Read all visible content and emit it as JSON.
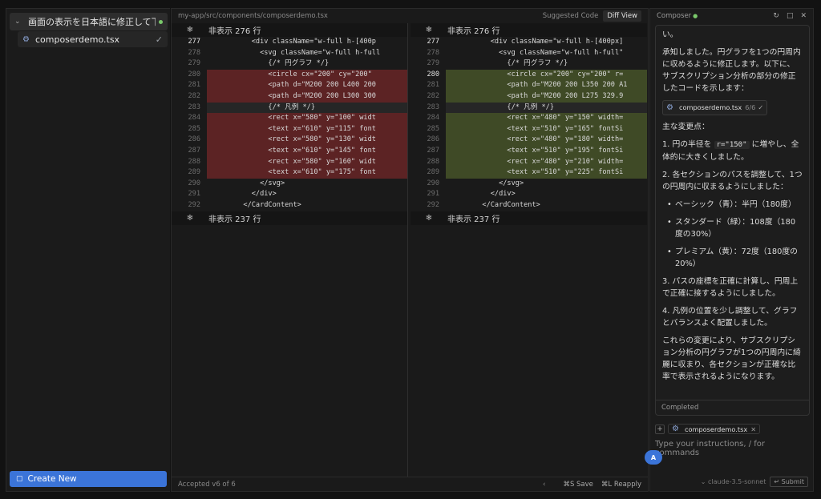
{
  "sidebar": {
    "conversation_title": "画面の表示を日本語に修正して下...",
    "file_name": "composerdemo.tsx",
    "create_new_label": "Create New"
  },
  "diff": {
    "file_path": "my-app/src/components/composerdemo.tsx",
    "suggested_code_label": "Suggested Code",
    "diff_view_label": "Diff View",
    "hidden_top": "非表示 276 行",
    "hidden_bottom": "非表示 237 行",
    "left_lines": [
      {
        "n": "277",
        "type": "ctx",
        "code": "          <div className=\"w-full h-[400p"
      },
      {
        "n": "278",
        "type": "ctx",
        "code": "            <svg className=\"w-full h-full"
      },
      {
        "n": "279",
        "type": "ctx",
        "code": "              {/* 円グラフ */}"
      },
      {
        "n": "280",
        "type": "del",
        "code": "              <circle cx=\"200\" cy=\"200\" "
      },
      {
        "n": "281",
        "type": "del",
        "code": "              <path d=\"M200 200 L400 200"
      },
      {
        "n": "282",
        "type": "del",
        "code": "              <path d=\"M200 200 L300 300"
      },
      {
        "n": "283",
        "type": "sel",
        "code": "              {/* 凡例 */}"
      },
      {
        "n": "284",
        "type": "del",
        "code": "              <rect x=\"580\" y=\"100\" widt"
      },
      {
        "n": "285",
        "type": "del",
        "code": "              <text x=\"610\" y=\"115\" font"
      },
      {
        "n": "286",
        "type": "del",
        "code": "              <rect x=\"580\" y=\"130\" widt"
      },
      {
        "n": "287",
        "type": "del",
        "code": "              <text x=\"610\" y=\"145\" font"
      },
      {
        "n": "288",
        "type": "del",
        "code": "              <rect x=\"580\" y=\"160\" widt"
      },
      {
        "n": "289",
        "type": "del",
        "code": "              <text x=\"610\" y=\"175\" font"
      },
      {
        "n": "290",
        "type": "ctx",
        "code": "            </svg>"
      },
      {
        "n": "291",
        "type": "ctx",
        "code": "          </div>"
      },
      {
        "n": "292",
        "type": "ctx",
        "code": "        </CardContent>"
      }
    ],
    "right_lines": [
      {
        "n": "277",
        "type": "ctx",
        "code": "          <div className=\"w-full h-[400px]"
      },
      {
        "n": "278",
        "type": "ctx",
        "code": "            <svg className=\"w-full h-full\""
      },
      {
        "n": "279",
        "type": "ctx",
        "code": "              {/* 円グラフ */}"
      },
      {
        "n": "280",
        "type": "add",
        "code": "              <circle cx=\"200\" cy=\"200\" r="
      },
      {
        "n": "281",
        "type": "add",
        "code": "              <path d=\"M200 200 L350 200 A1"
      },
      {
        "n": "282",
        "type": "add",
        "code": "              <path d=\"M200 200 L275 329.9"
      },
      {
        "n": "283",
        "type": "sel",
        "code": "              {/* 凡例 */}"
      },
      {
        "n": "284",
        "type": "add",
        "code": "              <rect x=\"480\" y=\"150\" width="
      },
      {
        "n": "285",
        "type": "add",
        "code": "              <text x=\"510\" y=\"165\" fontSi"
      },
      {
        "n": "286",
        "type": "add",
        "code": "              <rect x=\"480\" y=\"180\" width="
      },
      {
        "n": "287",
        "type": "add",
        "code": "              <text x=\"510\" y=\"195\" fontSi"
      },
      {
        "n": "288",
        "type": "add",
        "code": "              <rect x=\"480\" y=\"210\" width="
      },
      {
        "n": "289",
        "type": "add",
        "code": "              <text x=\"510\" y=\"225\" fontSi"
      },
      {
        "n": "290",
        "type": "ctx",
        "code": "            </svg>"
      },
      {
        "n": "291",
        "type": "ctx",
        "code": "          </div>"
      },
      {
        "n": "292",
        "type": "ctx",
        "code": "        </CardContent>"
      }
    ],
    "accepted_label": "Accepted v6 of 6",
    "save_label": "⌘S Save",
    "reapply_label": "⌘L Reapply"
  },
  "composer": {
    "title": "Composer",
    "partial_top": "い。",
    "intro": "承知しました。円グラフを1つの円周内に収めるように修正します。以下に、サブスクリプション分析の部分の修正したコードを示します：",
    "chip_file": "composerdemo.tsx",
    "chip_count": "6/6",
    "changes_heading": "主な変更点：",
    "change1_a": "1. 円の半径を ",
    "change1_code": "r=\"150\"",
    "change1_b": " に増やし、全体的に大きくしました。",
    "change2": "2. 各セクションのパスを調整して、1つの円周内に収まるようにしました：",
    "bullets": [
      "ベーシック（青）：半円（180度）",
      "スタンダード（緑）：108度（180度の30%）",
      "プレミアム（黄）：72度（180度の20%）"
    ],
    "change3": "3. パスの座標を正確に計算し、円周上で正確に接するようにしました。",
    "change4": "4. 凡例の位置を少し調整して、グラフとバランスよく配置しました。",
    "conclusion": "これらの変更により、サブスクリプション分析の円グラフが1つの円周内に綺麗に収まり、各セクションが正確な比率で表示されるようになります。",
    "completed_label": "Completed",
    "input_chip": "composerdemo.tsx",
    "input_placeholder": "Type your instructions, / for commands",
    "avatar_letter": "A",
    "model_label": "⌄ claude-3.5-sonnet",
    "submit_label": "↵ Submit"
  }
}
